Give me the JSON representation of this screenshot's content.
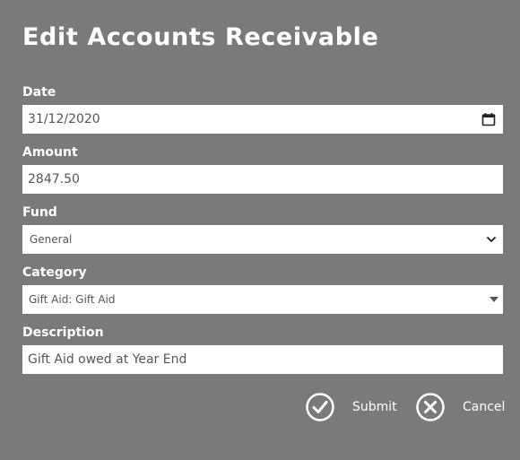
{
  "dialog": {
    "title": "Edit Accounts Receivable"
  },
  "fields": {
    "date": {
      "label": "Date",
      "value": "31/12/2020"
    },
    "amount": {
      "label": "Amount",
      "value": "2847.50"
    },
    "fund": {
      "label": "Fund",
      "value": "General"
    },
    "category": {
      "label": "Category",
      "value": "Gift Aid: Gift Aid"
    },
    "description": {
      "label": "Description",
      "value": "Gift Aid owed at Year End"
    }
  },
  "actions": {
    "submit_label": "Submit",
    "cancel_label": "Cancel"
  },
  "icons": {
    "date": "calendar-icon",
    "fund": "chevron-down-icon",
    "category": "caret-down-icon",
    "submit": "checkmark-circle-icon",
    "cancel": "x-circle-icon"
  },
  "colors": {
    "background": "#7a7a7a",
    "text": "#ffffff",
    "field_background": "#ffffff",
    "field_text": "#555555"
  }
}
